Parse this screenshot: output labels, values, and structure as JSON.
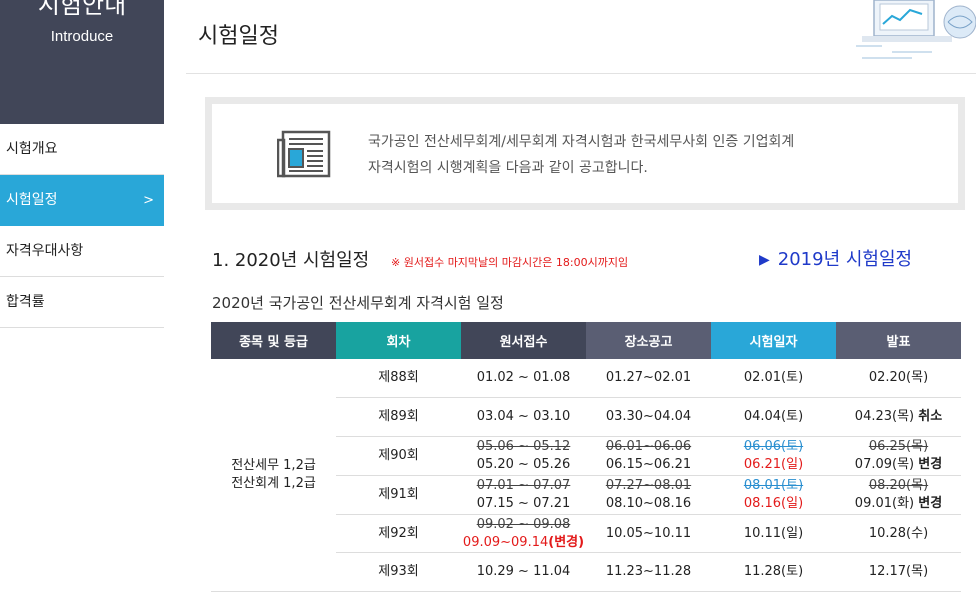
{
  "sidebar": {
    "title": "시험안내",
    "subtitle": "Introduce",
    "items": [
      {
        "label": "시험개요"
      },
      {
        "label": "시험일정",
        "arrow": ">"
      },
      {
        "label": "자격우대사항"
      },
      {
        "label": "합격률"
      }
    ]
  },
  "header": {
    "title": "시험일정"
  },
  "notice": {
    "line1": "국가공인 전산세무회계/세무회계 자격시험과 한국세무사회 인증 기업회계",
    "line2": "자격시험의 시행계획을 다음과 같이 공고합니다."
  },
  "section": {
    "heading": "1. 2020년 시험일정",
    "note": "※ 원서접수 마지막날의 마감시간은 18:00시까지임",
    "link_2019": "2019년 시험일정",
    "table_title": "2020년 국가공인 전산세무회계 자격시험 일정"
  },
  "table": {
    "headers": [
      "종목 및 등급",
      "회차",
      "원서접수",
      "장소공고",
      "시험일자",
      "발표"
    ],
    "grade_line1": "전산세무 1,2급",
    "grade_line2": "전산회계 1,2급",
    "rows": [
      {
        "round": "제88회",
        "apply": "01.02 ~ 01.08",
        "venue": "01.27~02.01",
        "exam": "02.01(토)",
        "result": "02.20(목)"
      },
      {
        "round": "제89회",
        "apply": "03.04 ~ 03.10",
        "venue": "03.30~04.04",
        "exam": "04.04(토)",
        "result": "04.23(목)",
        "result_note": "취소"
      },
      {
        "round": "제90회",
        "apply_old": "05.06 ~ 05.12",
        "apply": "05.20 ~ 05.26",
        "venue_old": "06.01~06.06",
        "venue": "06.15~06.21",
        "exam_old": "06.06(토)",
        "exam": "06.21(일)",
        "result_old": "06.25(목)",
        "result": "07.09(목)",
        "result_note": "변경"
      },
      {
        "round": "제91회",
        "apply_old": "07.01 ~ 07.07",
        "apply": "07.15 ~ 07.21",
        "venue_old": "07.27~08.01",
        "venue": "08.10~08.16",
        "exam_old": "08.01(토)",
        "exam": "08.16(일)",
        "result_old": "08.20(목)",
        "result": "09.01(화)",
        "result_note": "변경"
      },
      {
        "round": "제92회",
        "apply_old": "09.02 ~ 09.08",
        "apply": "09.09~09.14",
        "apply_note": "(변경)",
        "venue": "10.05~10.11",
        "exam": "10.11(일)",
        "result": "10.28(수)"
      },
      {
        "round": "제93회",
        "apply": "10.29 ~ 11.04",
        "venue": "11.23~11.28",
        "exam": "11.28(토)",
        "result": "12.17(목)"
      }
    ]
  },
  "colors": {
    "sidebar_dark": "#414658",
    "active_blue": "#29a7d8",
    "teal": "#18a3a0",
    "red": "#e31a1a",
    "link_blue": "#1f3ac9"
  },
  "icons": [
    "newspaper-icon",
    "play-triangle-icon",
    "decoration-illustration"
  ]
}
